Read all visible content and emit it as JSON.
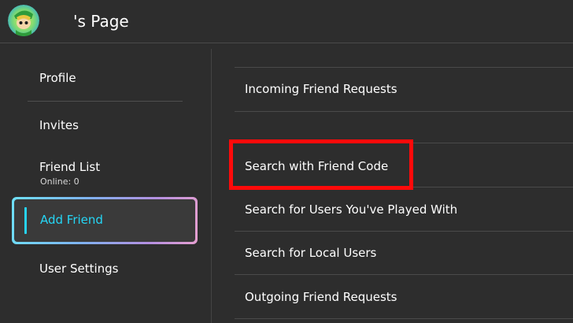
{
  "header": {
    "title": "'s Page",
    "avatar_icon": "user-avatar"
  },
  "sidebar": {
    "items": [
      {
        "label": "Profile"
      },
      {
        "label": "Invites"
      },
      {
        "label": "Friend List",
        "sub": "Online: 0"
      },
      {
        "label": "Add Friend",
        "selected": true
      },
      {
        "label": "User Settings"
      }
    ]
  },
  "main": {
    "items": [
      {
        "label": "Incoming Friend Requests"
      },
      {
        "label": "Search with Friend Code",
        "highlighted": true
      },
      {
        "label": "Search for Users You've Played With"
      },
      {
        "label": "Search for Local Users"
      },
      {
        "label": "Outgoing Friend Requests"
      }
    ]
  },
  "colors": {
    "background": "#2d2d2d",
    "selected_text": "#25d6f5",
    "highlight_border": "#ff0a0a"
  }
}
